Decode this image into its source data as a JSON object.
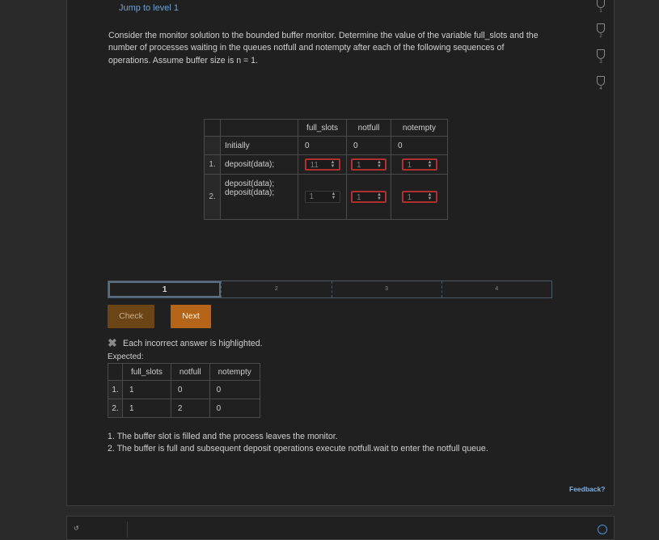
{
  "header": {
    "jump_link": "Jump to level 1"
  },
  "levels": [
    {
      "num": "1"
    },
    {
      "num": "2"
    },
    {
      "num": "3"
    },
    {
      "num": "4"
    }
  ],
  "prompt": "Consider the monitor solution to the bounded buffer monitor. Determine the value of the variable full_slots and the number of processes waiting in the queues notfull and notempty after each of the following sequences of operations. Assume buffer size is n = 1.",
  "question_table": {
    "headers": [
      "full_slots",
      "notfull",
      "notempty"
    ],
    "initial": {
      "label": "Initially",
      "values": [
        "0",
        "0",
        "0"
      ]
    },
    "rows": [
      {
        "idx": "1.",
        "op": "deposit(data);",
        "inputs": [
          "11",
          "1",
          "1"
        ]
      },
      {
        "idx": "2.",
        "op1": "deposit(data);",
        "op2": "deposit(data);",
        "inputs": [
          "1",
          "1",
          "1"
        ]
      }
    ]
  },
  "steps": [
    {
      "label": "1",
      "active": true
    },
    {
      "label": "2",
      "active": false
    },
    {
      "label": "3",
      "active": false
    },
    {
      "label": "4",
      "active": false
    }
  ],
  "buttons": {
    "check": "Check",
    "next": "Next"
  },
  "feedback": {
    "message": "Each incorrect answer is highlighted.",
    "expected_label": "Expected:",
    "table": {
      "headers": [
        "full_slots",
        "notfull",
        "notempty"
      ],
      "rows": [
        {
          "idx": "1.",
          "values": [
            "1",
            "0",
            "0"
          ]
        },
        {
          "idx": "2.",
          "values": [
            "1",
            "2",
            "0"
          ]
        }
      ]
    },
    "explanations": [
      "1. The buffer slot is filled and the process leaves the monitor.",
      "2. The buffer is full and subsequent deposit operations execute notfull.wait to enter the notfull queue."
    ]
  },
  "footer": {
    "feedback_link": "Feedback?"
  },
  "colors": {
    "accent": "#b46519",
    "error_border": "#b03030",
    "link": "#6fa2d6"
  }
}
